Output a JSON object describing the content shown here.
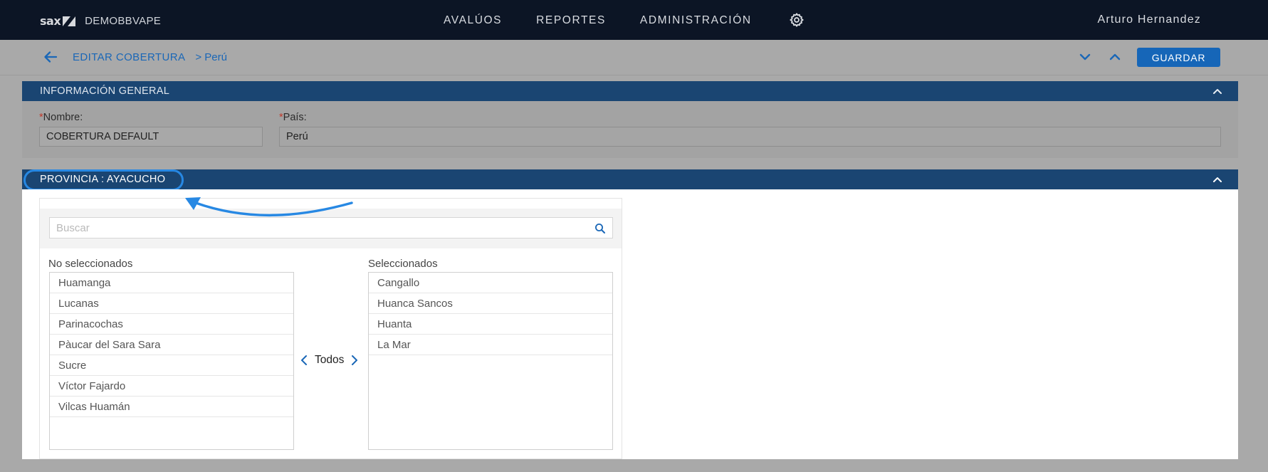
{
  "nav": {
    "brand_logo": "sax",
    "brand_name": "DEMOBBVAPE",
    "menu": [
      "AVALÚOS",
      "REPORTES",
      "ADMINISTRACIÓN"
    ],
    "settings_icon": "gear-icon",
    "user": "Arturo Hernandez"
  },
  "subheader": {
    "back_icon": "arrow-left-icon",
    "title": "EDITAR COBERTURA",
    "crumb": "> Perú",
    "save_label": "GUARDAR"
  },
  "general": {
    "title": "INFORMACIÓN GENERAL",
    "name_required": "*",
    "name_label": "Nombre:",
    "name_value": "COBERTURA DEFAULT",
    "country_required": "*",
    "country_label": "País:",
    "country_value": "Perú"
  },
  "provincia": {
    "title": "PROVINCIA : AYACUCHO",
    "search_placeholder": "Buscar",
    "unselected_title": "No seleccionados",
    "unselected": [
      "Huamanga",
      "Lucanas",
      "Parinacochas",
      "Pàucar del Sara Sara",
      "Sucre",
      "Víctor Fajardo",
      "Vilcas Huamán"
    ],
    "selected_title": "Seleccionados",
    "selected": [
      "Cangallo",
      "Huanca Sancos",
      "Huanta",
      "La Mar"
    ],
    "move_all_label": "Todos"
  },
  "colors": {
    "nav_bg": "#0c1525",
    "section_bar": "#1a4572",
    "accent": "#1666b8",
    "highlight": "#2788e3",
    "overlay_bg": "#a9a9a9"
  }
}
